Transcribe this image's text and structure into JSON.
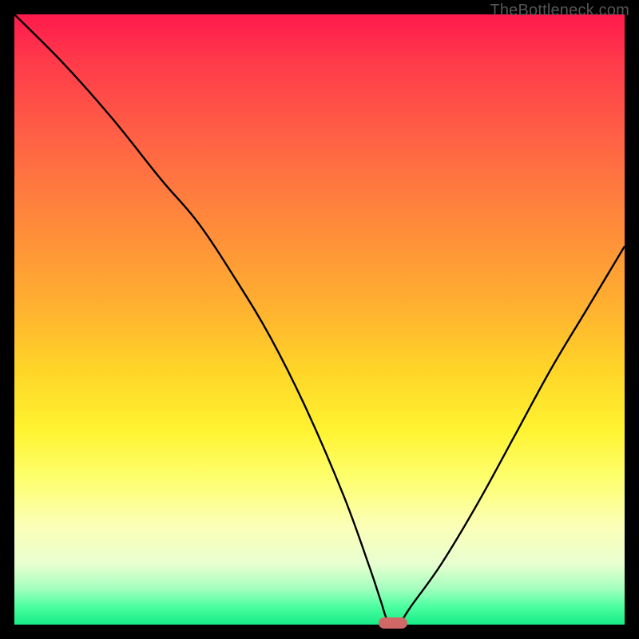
{
  "watermark": "TheBottleneck.com",
  "chart_data": {
    "type": "line",
    "title": "",
    "xlabel": "",
    "ylabel": "",
    "watermark": "TheBottleneck.com",
    "background_gradient": {
      "description": "Vertical red-to-green gradient, red at top meaning high bottleneck, green at bottom meaning zero bottleneck",
      "stops": [
        {
          "pos": 0.0,
          "color": "#ff1a4d"
        },
        {
          "pos": 0.5,
          "color": "#ffb130"
        },
        {
          "pos": 0.75,
          "color": "#feff6e"
        },
        {
          "pos": 1.0,
          "color": "#17ec88"
        }
      ]
    },
    "xlim": [
      0,
      100
    ],
    "ylim": [
      0,
      100
    ],
    "series": [
      {
        "name": "bottleneck-curve",
        "note": "V-shaped curve; y is bottleneck percentage (100=top, 0=bottom); global minimum near x≈62",
        "x": [
          0,
          8,
          16,
          24,
          30,
          36,
          42,
          48,
          54,
          58,
          60,
          61,
          62,
          63,
          65,
          70,
          76,
          82,
          88,
          94,
          100
        ],
        "values": [
          100,
          92,
          83,
          73,
          66,
          57,
          47,
          35,
          21,
          10,
          4,
          1,
          0,
          0,
          3,
          10,
          20,
          31,
          42,
          52,
          62
        ]
      }
    ],
    "marker": {
      "name": "optimal-point",
      "shape": "rounded-rectangle",
      "color": "#d06868",
      "x": 62,
      "y": 0,
      "note": "Highlights the minimum of the curve on the x-axis"
    }
  }
}
